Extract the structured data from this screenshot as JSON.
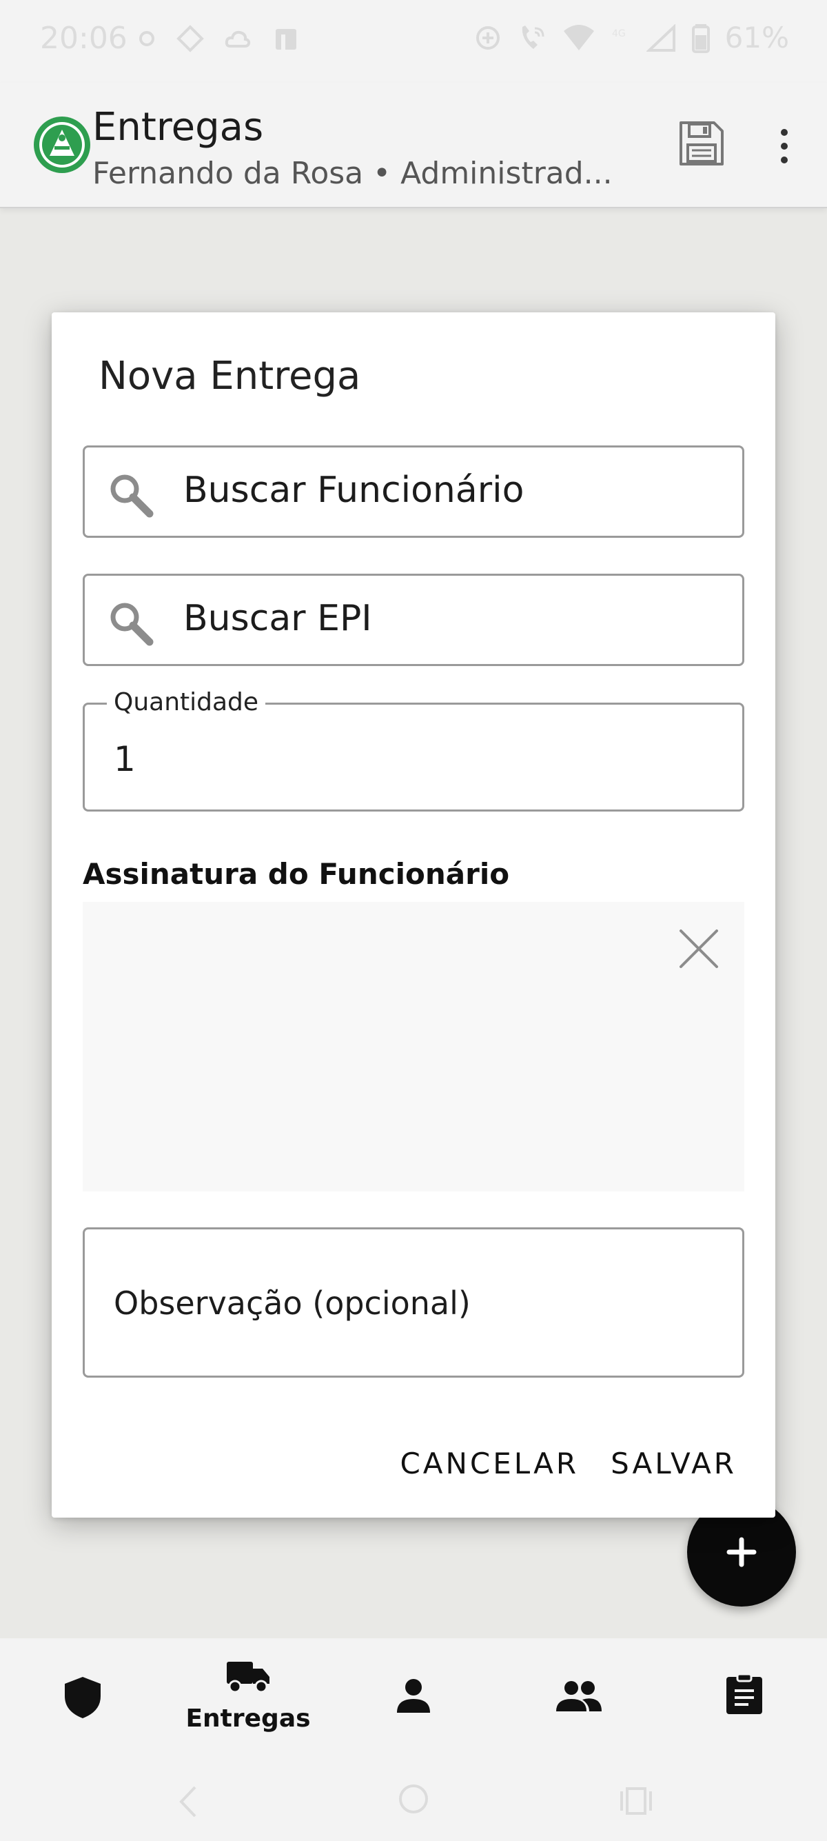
{
  "status_bar": {
    "time": "20:06",
    "battery": "61%"
  },
  "app_bar": {
    "title": "Entregas",
    "subtitle": "Fernando da Rosa • Administrad..."
  },
  "dialog": {
    "title": "Nova Entrega",
    "employee_search_placeholder": "Buscar Funcionário",
    "epi_search_placeholder": "Buscar EPI",
    "quantity_label": "Quantidade",
    "quantity_value": "1",
    "signature_label": "Assinatura do Funcionário",
    "observation_placeholder": "Observação (opcional)",
    "cancel_label": "CANCELAR",
    "save_label": "SALVAR"
  },
  "fab": {
    "icon": "plus-icon",
    "label": "+"
  },
  "bottom_nav": {
    "items": [
      {
        "icon": "shield-icon",
        "label": "",
        "selected": false
      },
      {
        "icon": "truck-icon",
        "label": "Entregas",
        "selected": true
      },
      {
        "icon": "person-icon",
        "label": "",
        "selected": false
      },
      {
        "icon": "group-icon",
        "label": "",
        "selected": false
      },
      {
        "icon": "clipboard-icon",
        "label": "",
        "selected": false
      }
    ]
  },
  "colors": {
    "accent": "#2e9e4f",
    "dialog_bg": "#ffffff",
    "scrim": "#e9e9e6",
    "fab": "#0a0a0a"
  }
}
